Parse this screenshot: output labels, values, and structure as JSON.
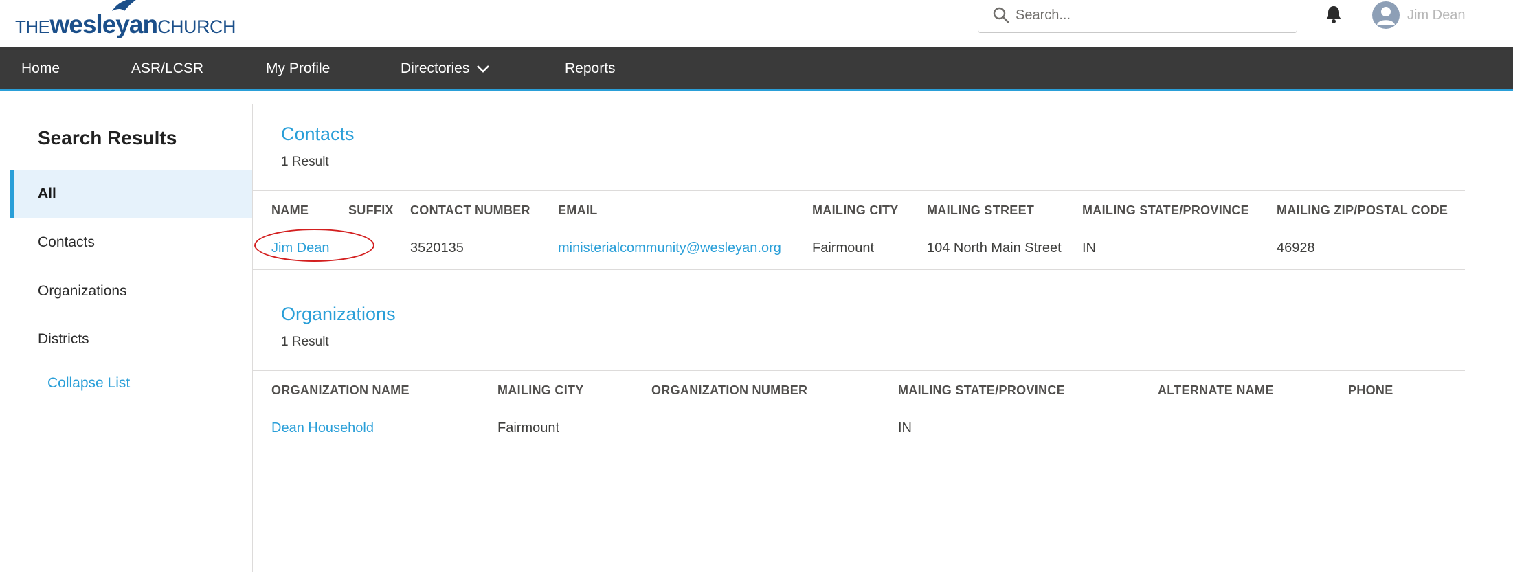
{
  "header": {
    "logo": {
      "the": "THE",
      "wes": "wesleyan",
      "church": "CHURCH"
    },
    "search": {
      "placeholder": "Search..."
    },
    "user": {
      "name": "Jim Dean"
    }
  },
  "nav": {
    "items": [
      {
        "label": "Home"
      },
      {
        "label": "ASR/LCSR"
      },
      {
        "label": "My Profile"
      },
      {
        "label": "Directories"
      },
      {
        "label": "Reports"
      }
    ]
  },
  "sidebar": {
    "title": "Search Results",
    "items": [
      {
        "label": "All",
        "active": true
      },
      {
        "label": "Contacts"
      },
      {
        "label": "Organizations"
      },
      {
        "label": "Districts"
      }
    ],
    "collapse_label": "Collapse List"
  },
  "contacts": {
    "title": "Contacts",
    "count": "1 Result",
    "columns": [
      "NAME",
      "SUFFIX",
      "CONTACT NUMBER",
      "EMAIL",
      "MAILING CITY",
      "MAILING STREET",
      "MAILING STATE/PROVINCE",
      "MAILING ZIP/POSTAL CODE"
    ],
    "rows": [
      {
        "name": "Jim Dean",
        "suffix": "",
        "contact_number": "3520135",
        "email": "ministerialcommunity@wesleyan.org",
        "city": "Fairmount",
        "street": "104 North Main Street",
        "state": "IN",
        "zip": "46928"
      }
    ]
  },
  "organizations": {
    "title": "Organizations",
    "count": "1 Result",
    "columns": [
      "ORGANIZATION NAME",
      "MAILING CITY",
      "ORGANIZATION NUMBER",
      "MAILING STATE/PROVINCE",
      "ALTERNATE NAME",
      "PHONE"
    ],
    "rows": [
      {
        "name": "Dean Household",
        "city": "Fairmount",
        "number": "",
        "state": "IN",
        "alternate_name": "",
        "phone": ""
      }
    ]
  },
  "colors": {
    "accent": "#2a9fd8",
    "nav_bg": "#3a3a3a",
    "brand": "#1b4f8a",
    "annotation": "#d31f1f"
  }
}
